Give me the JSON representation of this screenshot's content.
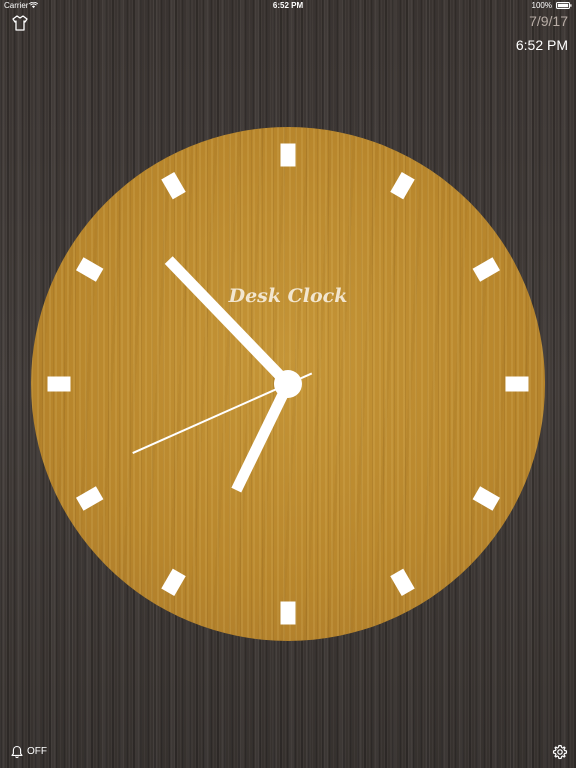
{
  "status_bar": {
    "carrier": "Carrier",
    "time": "6:52 PM",
    "battery": "100%",
    "wifi_icon": "wifi-icon",
    "battery_icon": "battery-icon"
  },
  "header": {
    "theme_icon": "shirt-icon",
    "date": "7/9/17",
    "time": "6:52 PM"
  },
  "clock": {
    "brand": "Desk Clock",
    "hour": 6,
    "minute": 52,
    "second": 41,
    "face_color": "#b8862c",
    "hand_color": "#ffffff",
    "marker_color": "#ffffff"
  },
  "footer": {
    "alarm_icon": "bell-icon",
    "alarm_state": "OFF",
    "settings_icon": "gear-icon"
  }
}
